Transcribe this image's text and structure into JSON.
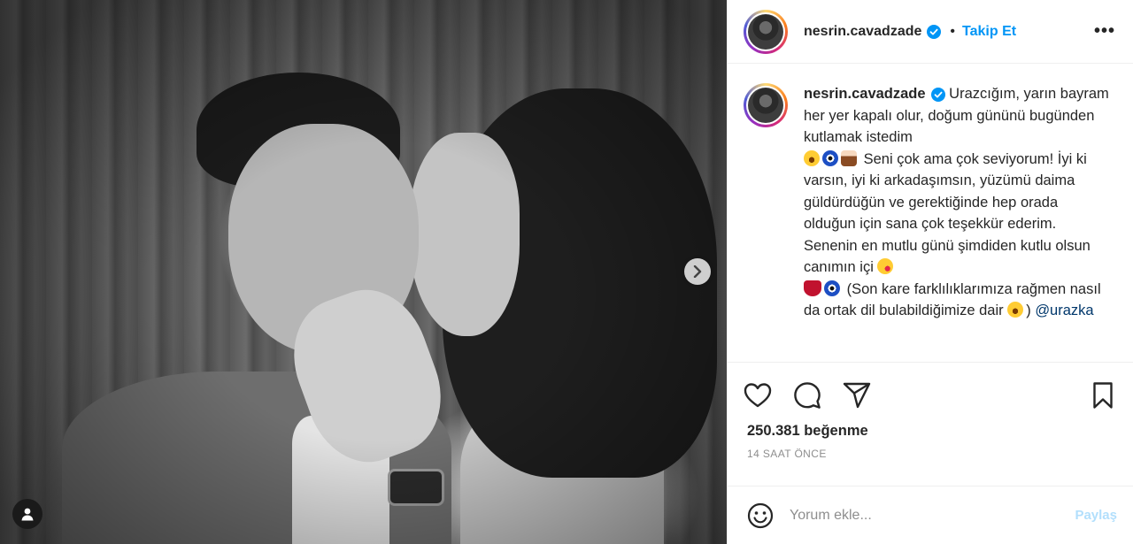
{
  "post": {
    "username": "nesrin.cavadzade",
    "follow_label": "Takip Et",
    "separator": "•",
    "more_label": "•••",
    "caption": {
      "username": "nesrin.cavadzade",
      "line1": "Urazcığım, yarın bayram her yer kapalı olur, doğum gününü bugünden kutlamak istedim",
      "line2": "Seni çok ama çok seviyorum! İyi ki varsın, iyi ki arkadaşımsın, yüzümü daima güldürdüğün ve gerektiğinde hep orada olduğun için sana çok teşekkür ederim. Senenin en mutlu günü şimdiden kutlu olsun canımın içi",
      "line3": "(Son kare farklılıklarımıza rağmen nasıl da ortak dil bulabildiğimize dair",
      "line3_end": ")",
      "mention": "@urazka"
    },
    "likes": "250.381 beğenme",
    "timestamp": "14 SAAT ÖNCE"
  },
  "comment": {
    "placeholder": "Yorum ekle...",
    "post_label": "Paylaş"
  },
  "icons": {
    "verified": "verified-badge-icon",
    "like": "heart-icon",
    "comment": "comment-icon",
    "share": "share-icon",
    "save": "bookmark-icon",
    "emoji": "emoji-icon",
    "next": "chevron-right-icon",
    "tag": "user-tag-icon"
  },
  "colors": {
    "accent": "#0095f6",
    "text": "#262626",
    "muted": "#8e8e8e",
    "post_disabled": "#b2dffc"
  }
}
